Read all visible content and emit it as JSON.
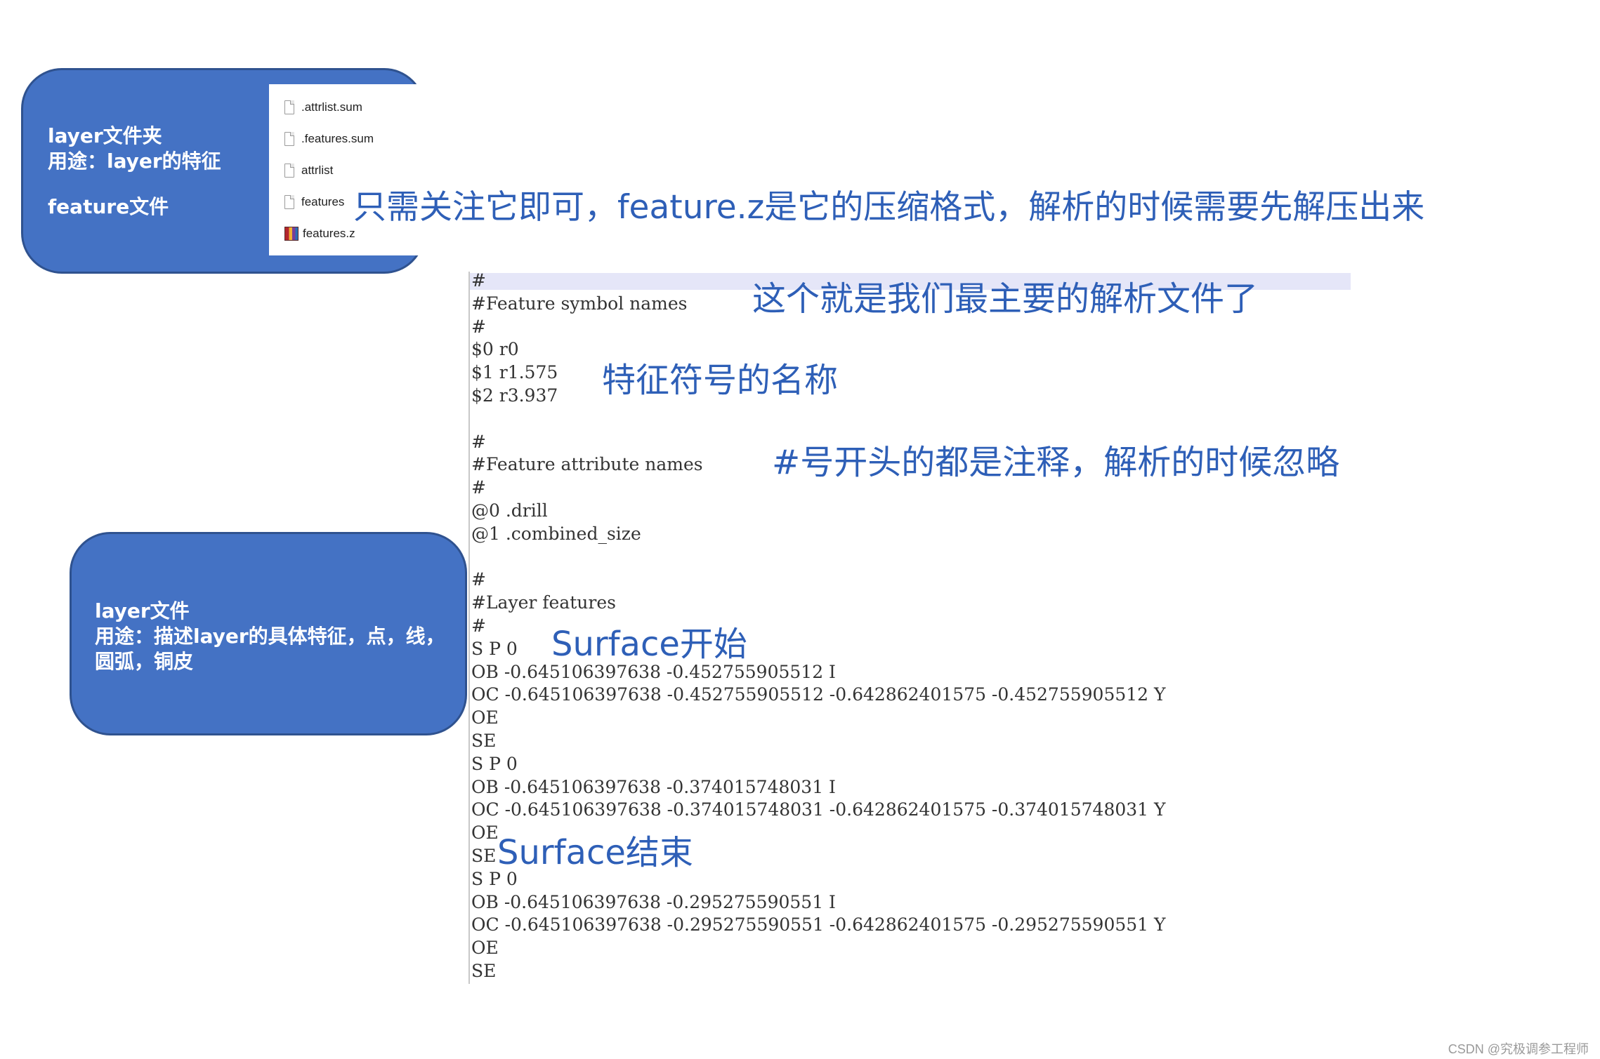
{
  "box_layer_folder": {
    "line1": "layer文件夹\n用途：layer的特征",
    "line2": "feature文件"
  },
  "box_layer_file": {
    "text": "layer文件\n用途：描述layer的具体特征，点，线，圆弧，铜皮"
  },
  "file_list": [
    {
      "name": ".attrlist.sum",
      "icon": "file-icon"
    },
    {
      "name": ".features.sum",
      "icon": "file-icon"
    },
    {
      "name": "attrlist",
      "icon": "file-icon"
    },
    {
      "name": "features",
      "icon": "file-icon"
    },
    {
      "name": "features.z",
      "icon": "archive-icon"
    }
  ],
  "annotations": {
    "features_note": "只需关注它即可，feature.z是它的压缩格式，解析的时候需要先解压出来",
    "main_file": "这个就是我们最主要的解析文件了",
    "symbol_names": "特征符号的名称",
    "comment_note": "#号开头的都是注释，解析的时候忽略",
    "surface_start": "Surface开始",
    "surface_end": "Surface结束"
  },
  "code_lines": [
    "#",
    "#Feature symbol names",
    "#",
    "$0 r0",
    "$1 r1.575",
    "$2 r3.937",
    "",
    "#",
    "#Feature attribute names",
    "#",
    "@0 .drill",
    "@1 .combined_size",
    "",
    "#",
    "#Layer features",
    "#",
    "S P 0",
    "OB -0.645106397638 -0.452755905512 I",
    "OC -0.645106397638 -0.452755905512 -0.642862401575 -0.452755905512 Y",
    "OE",
    "SE",
    "S P 0",
    "OB -0.645106397638 -0.374015748031 I",
    "OC -0.645106397638 -0.374015748031 -0.642862401575 -0.374015748031 Y",
    "OE",
    "SE",
    "S P 0",
    "OB -0.645106397638 -0.295275590551 I",
    "OC -0.645106397638 -0.295275590551 -0.642862401575 -0.295275590551 Y",
    "OE",
    "SE"
  ],
  "watermark": "CSDN @究极调参工程师",
  "colors": {
    "box_fill": "#4472c4",
    "box_border": "#2f528f",
    "annotation": "#2e5fb7"
  }
}
